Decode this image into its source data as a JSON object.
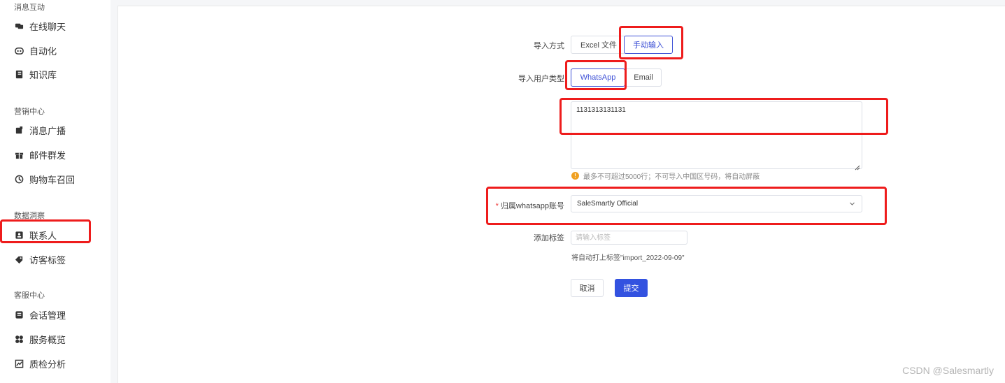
{
  "sidebar": {
    "sections": [
      {
        "title": "消息互动",
        "items": [
          {
            "label": "在线聊天",
            "icon": "chat-icon"
          },
          {
            "label": "自动化",
            "icon": "robot-icon"
          },
          {
            "label": "知识库",
            "icon": "book-icon"
          }
        ]
      },
      {
        "title": "营销中心",
        "items": [
          {
            "label": "消息广播",
            "icon": "broadcast-icon"
          },
          {
            "label": "邮件群发",
            "icon": "gift-icon"
          },
          {
            "label": "购物车召回",
            "icon": "cart-recall-icon"
          }
        ]
      },
      {
        "title": "数据洞察",
        "items": [
          {
            "label": "联系人",
            "icon": "contact-icon"
          },
          {
            "label": "访客标签",
            "icon": "tag-icon"
          }
        ]
      },
      {
        "title": "客服中心",
        "items": [
          {
            "label": "会话管理",
            "icon": "session-icon"
          },
          {
            "label": "服务概览",
            "icon": "overview-icon"
          },
          {
            "label": "质检分析",
            "icon": "chart-icon"
          }
        ]
      }
    ]
  },
  "form": {
    "import_method": {
      "label": "导入方式",
      "options": [
        "Excel 文件",
        "手动输入"
      ],
      "selected": "手动输入"
    },
    "user_type": {
      "label": "导入用户类型",
      "options": [
        "WhatsApp",
        "Email"
      ],
      "selected": "WhatsApp"
    },
    "numbers": {
      "value": "1131313131131",
      "hint": "最多不可超过5000行；不可导入中国区号码，将自动屏蔽"
    },
    "account": {
      "label": "归属whatsapp账号",
      "required_mark": "*",
      "value": "SaleSmartly Official"
    },
    "tags": {
      "label": "添加标签",
      "placeholder": "请输入标签",
      "auto_note": "将自动打上标签\"import_2022-09-09\""
    },
    "cancel_label": "取消",
    "submit_label": "提交"
  },
  "watermark": "CSDN @Salesmartly",
  "colors": {
    "primary": "#3352e0",
    "highlight_box": "#ee1c1c",
    "warning": "#f0a020"
  }
}
